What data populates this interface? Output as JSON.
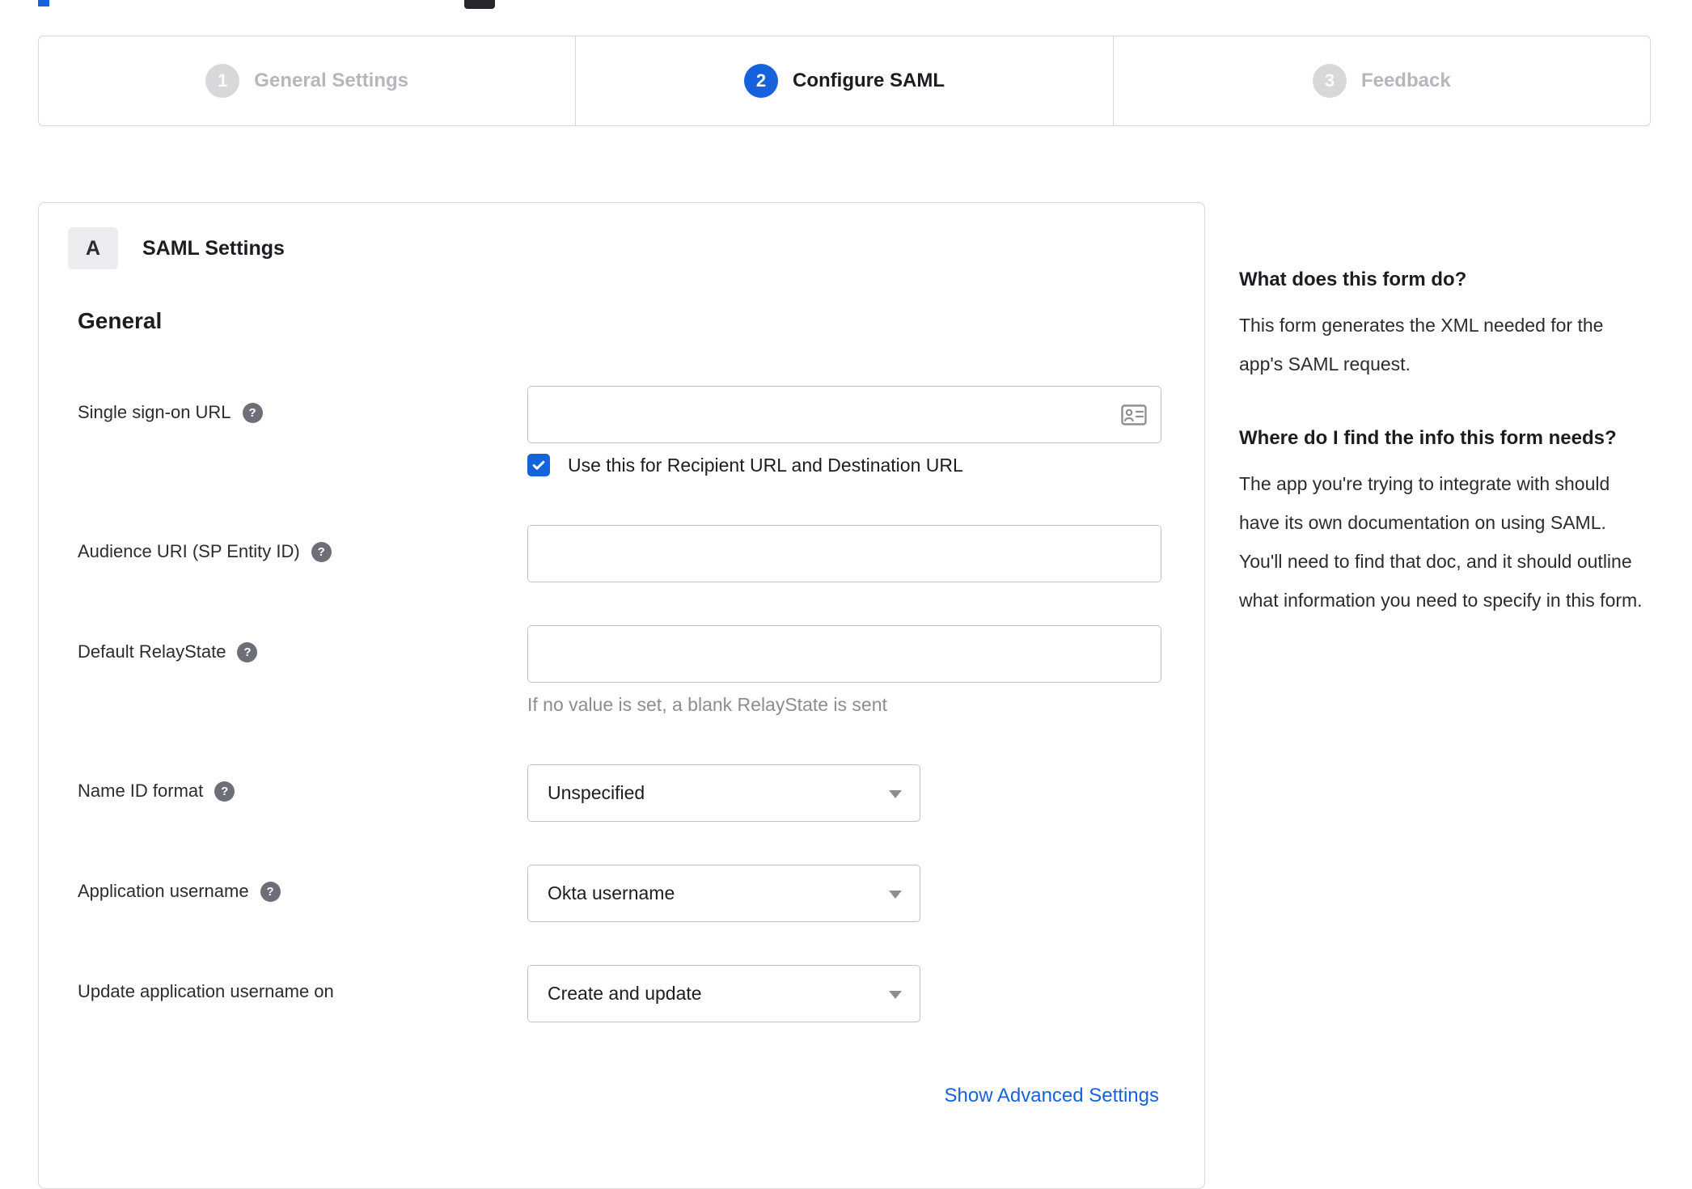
{
  "icons": {
    "help": "?"
  },
  "colors": {
    "accent_blue": "#1662dd",
    "step_inactive_circle": "#d8d8da",
    "panel_border": "#d8d8da",
    "hint_text": "#8d8d91"
  },
  "stepper": {
    "steps": [
      {
        "number": "1",
        "label": "General Settings",
        "state": "inactive"
      },
      {
        "number": "2",
        "label": "Configure SAML",
        "state": "active"
      },
      {
        "number": "3",
        "label": "Feedback",
        "state": "inactive"
      }
    ]
  },
  "panel": {
    "badge": "A",
    "title": "SAML Settings",
    "section_title": "General",
    "fields": {
      "sso_url": {
        "label": "Single sign-on URL",
        "value": "",
        "checkbox_label": "Use this for Recipient URL and Destination URL",
        "checkbox_checked": true
      },
      "audience_uri": {
        "label": "Audience URI (SP Entity ID)",
        "value": ""
      },
      "relay_state": {
        "label": "Default RelayState",
        "value": "",
        "hint": "If no value is set, a blank RelayState is sent"
      },
      "name_id_format": {
        "label": "Name ID format",
        "value": "Unspecified"
      },
      "app_username": {
        "label": "Application username",
        "value": "Okta username"
      },
      "update_app_username": {
        "label": "Update application username on",
        "value": "Create and update"
      }
    },
    "advanced_link": "Show Advanced Settings"
  },
  "sidebar": {
    "sections": [
      {
        "heading": "What does this form do?",
        "body": "This form generates the XML needed for the app's SAML request."
      },
      {
        "heading": "Where do I find the info this form needs?",
        "body": "The app you're trying to integrate with should have its own documentation on using SAML. You'll need to find that doc, and it should outline what information you need to specify in this form."
      }
    ]
  }
}
